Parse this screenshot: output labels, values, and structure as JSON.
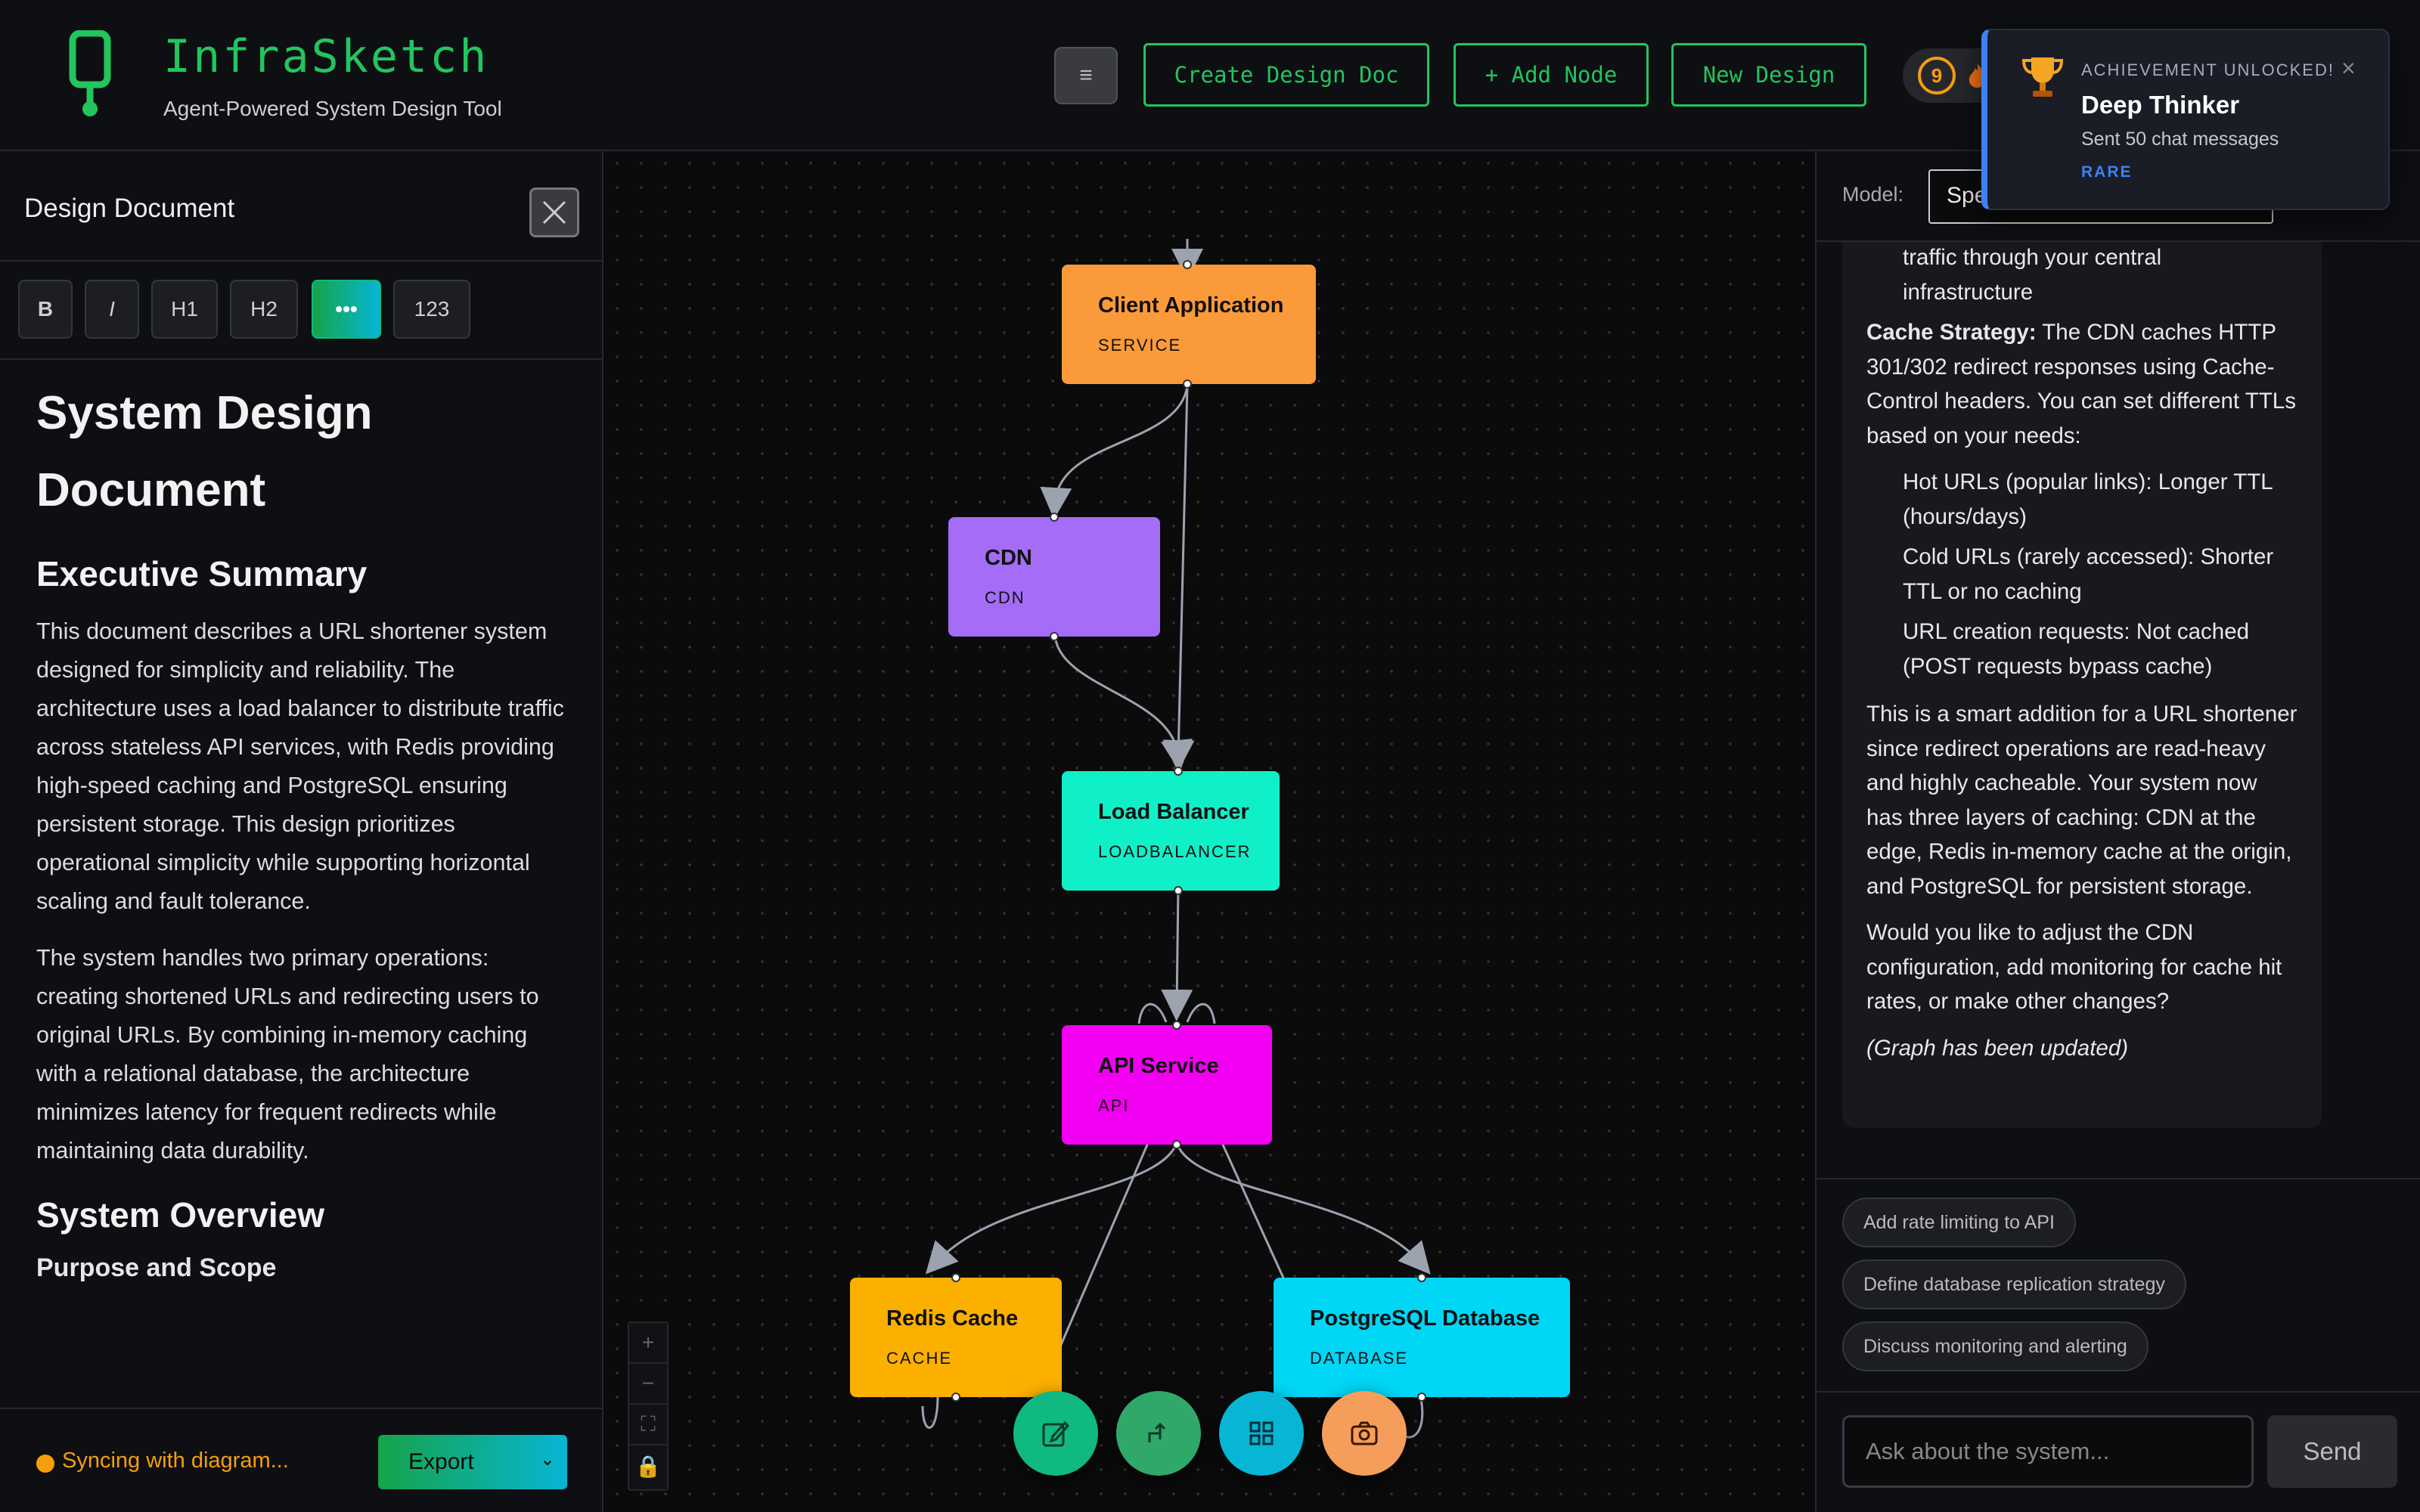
{
  "header": {
    "app_title": "InfraSketch",
    "subtitle": "Agent-Powered System Design Tool",
    "menu_icon": "≡",
    "buttons": {
      "create_doc": "Create Design Doc",
      "add_node": "+ Add Node",
      "new_design": "New Design"
    },
    "level": "9"
  },
  "document": {
    "panel_title": "Design Document",
    "toolbar": [
      "B",
      "I",
      "H1",
      "H2",
      "•••",
      "123"
    ],
    "h1": "System Design Document",
    "section1": "Executive Summary",
    "p1": "This document describes a URL shortener system designed for simplicity and reliability. The architecture uses a load balancer to distribute traffic across stateless API services, with Redis providing high-speed caching and PostgreSQL ensuring persistent storage. This design prioritizes operational simplicity while supporting horizontal scaling and fault tolerance.",
    "p2": "The system handles two primary operations: creating shortened URLs and redirecting users to original URLs. By combining in-memory caching with a relational database, the architecture minimizes latency for frequent redirects while maintaining data durability.",
    "section2": "System Overview",
    "partial_line": "Purpose and Scope",
    "sync_status": "Syncing with diagram...",
    "export_label": "Export"
  },
  "canvas": {
    "nodes": [
      {
        "label": "Client Application",
        "type": "SERVICE",
        "color": "#fb9a3a"
      },
      {
        "label": "CDN",
        "type": "CDN",
        "color": "#a56cf7"
      },
      {
        "label": "Load Balancer",
        "type": "LOADBALANCER",
        "color": "#10f0c8"
      },
      {
        "label": "API Service",
        "type": "API",
        "color": "#f200f2"
      },
      {
        "label": "Redis Cache",
        "type": "CACHE",
        "color": "#fbb000"
      },
      {
        "label": "PostgreSQL Database",
        "type": "DATABASE",
        "color": "#00d6f5"
      }
    ],
    "zoom_controls": [
      "+",
      "−",
      "⛶",
      "🔒"
    ],
    "fab_icons": [
      "edit-icon",
      "layout-icon",
      "grid-icon",
      "camera-icon"
    ]
  },
  "chat": {
    "model_label": "Model:",
    "model_value": "Spe",
    "line0": "traffic through your central infrastructure",
    "cache_strategy_label": "Cache Strategy:",
    "cache_strategy_text": " The CDN caches HTTP 301/302 redirect responses using Cache-Control headers. You can set different TTLs based on your needs:",
    "bullets": [
      "Hot URLs (popular links): Longer TTL (hours/days)",
      "Cold URLs (rarely accessed): Shorter TTL or no caching",
      "URL creation requests: Not cached (POST requests bypass cache)"
    ],
    "p_summary": "This is a smart addition for a URL shortener since redirect operations are read-heavy and highly cacheable. Your system now has three layers of caching: CDN at the edge, Redis in-memory cache at the origin, and PostgreSQL for persistent storage.",
    "p_question": "Would you like to adjust the CDN configuration, add monitoring for cache hit rates, or make other changes?",
    "p_updated": "(Graph has been updated)",
    "suggestions": [
      "Add rate limiting to API",
      "Define database replication strategy",
      "Discuss monitoring and alerting"
    ],
    "input_placeholder": "Ask about the system...",
    "send_label": "Send"
  },
  "toast": {
    "kicker": "ACHIEVEMENT UNLOCKED!",
    "title": "Deep Thinker",
    "description": "Sent 50 chat messages",
    "rarity": "RARE",
    "close": "×"
  }
}
